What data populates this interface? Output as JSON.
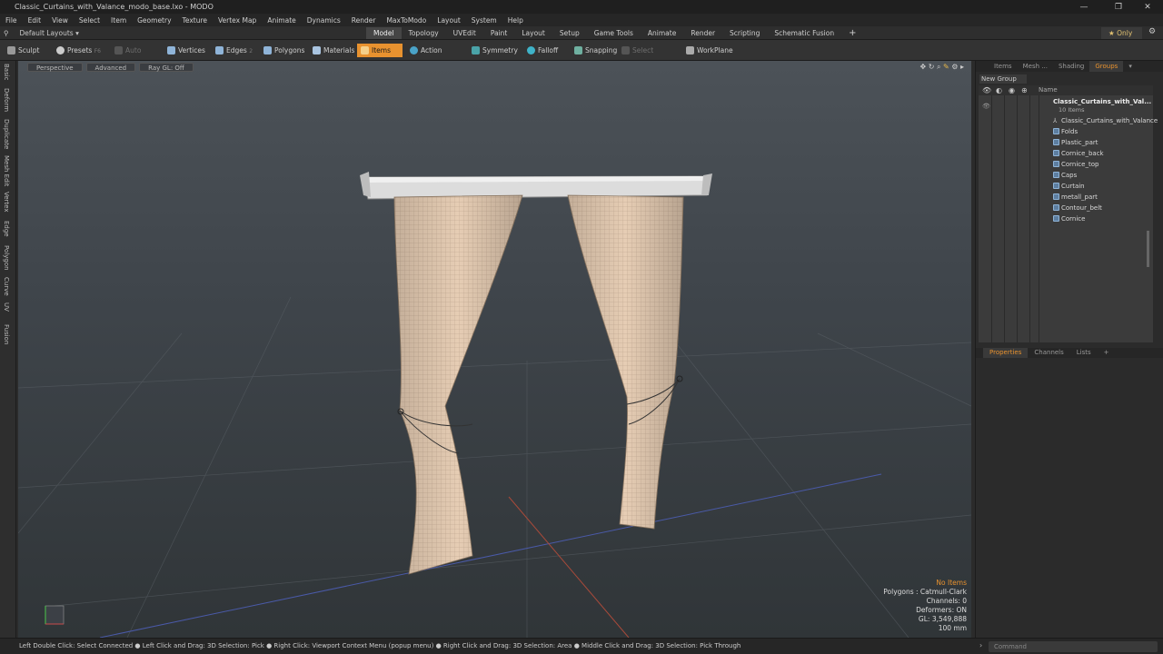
{
  "window": {
    "title": "Classic_Curtains_with_Valance_modo_base.lxo - MODO",
    "minimize": "—",
    "maximize": "❐",
    "close": "✕"
  },
  "menu": [
    "File",
    "Edit",
    "View",
    "Select",
    "Item",
    "Geometry",
    "Texture",
    "Vertex Map",
    "Animate",
    "Dynamics",
    "Render",
    "MaxToModo",
    "Layout",
    "System",
    "Help"
  ],
  "layoutbar": {
    "layouts_label": "Default Layouts ▾",
    "tabs": [
      "Model",
      "Topology",
      "UVEdit",
      "Paint",
      "Layout",
      "Setup",
      "Game Tools",
      "Animate",
      "Render",
      "Scripting",
      "Schematic Fusion"
    ],
    "active_tab": "Model",
    "add_tab": "+",
    "only_label": "Only",
    "gear": "⚙"
  },
  "toolbar": {
    "sculpt": "Sculpt",
    "presets": "Presets",
    "presets_key": "F6",
    "auto_select": "Auto Select",
    "vertices": "Vertices",
    "vertices_key": "1",
    "edges": "Edges",
    "edges_key": "2",
    "polygons": "Polygons",
    "materials": "Materials",
    "items": "Items",
    "action_center": "Action Center",
    "symmetry": "Symmetry",
    "falloff": "Falloff",
    "snapping": "Snapping",
    "select_through": "Select Through",
    "workplane": "WorkPlane"
  },
  "left_tabs": [
    "Basic",
    "Deform",
    "Duplicate",
    "Mesh Edit",
    "Vertex",
    "Edge",
    "Polygon",
    "Curve",
    "UV",
    "Fusion"
  ],
  "viewport": {
    "perspective": "Perspective",
    "advanced": "Advanced",
    "raygl": "Ray GL: Off",
    "stats": {
      "no_items": "No Items",
      "polygons": "Polygons : Catmull-Clark",
      "channels": "Channels: 0",
      "deformers": "Deformers: ON",
      "gl": "GL: 3,549,888",
      "scale": "100 mm"
    }
  },
  "right_panel": {
    "tabs": [
      "Items",
      "Mesh ...",
      "Shading",
      "Groups"
    ],
    "active_tab": "Groups",
    "new_group": "New Group",
    "name_header": "Name",
    "root": "Classic_Curtains_with_Val...",
    "root_count": "10 Items",
    "items": [
      "Classic_Curtains_with_Valance",
      "Folds",
      "Plastic_part",
      "Cornice_back",
      "Cornice_top",
      "Caps",
      "Curtain",
      "metall_part",
      "Contour_belt",
      "Cornice"
    ]
  },
  "properties_tabs": [
    "Properties",
    "Channels",
    "Lists"
  ],
  "properties_add": "+",
  "statusbar": {
    "hint": "Left Double Click: Select Connected ● Left Click and Drag: 3D Selection: Pick ● Right Click: Viewport Context Menu (popup menu) ● Right Click and Drag: 3D Selection: Area ● Middle Click and Drag: 3D Selection: Pick Through",
    "command_placeholder": "Command"
  }
}
